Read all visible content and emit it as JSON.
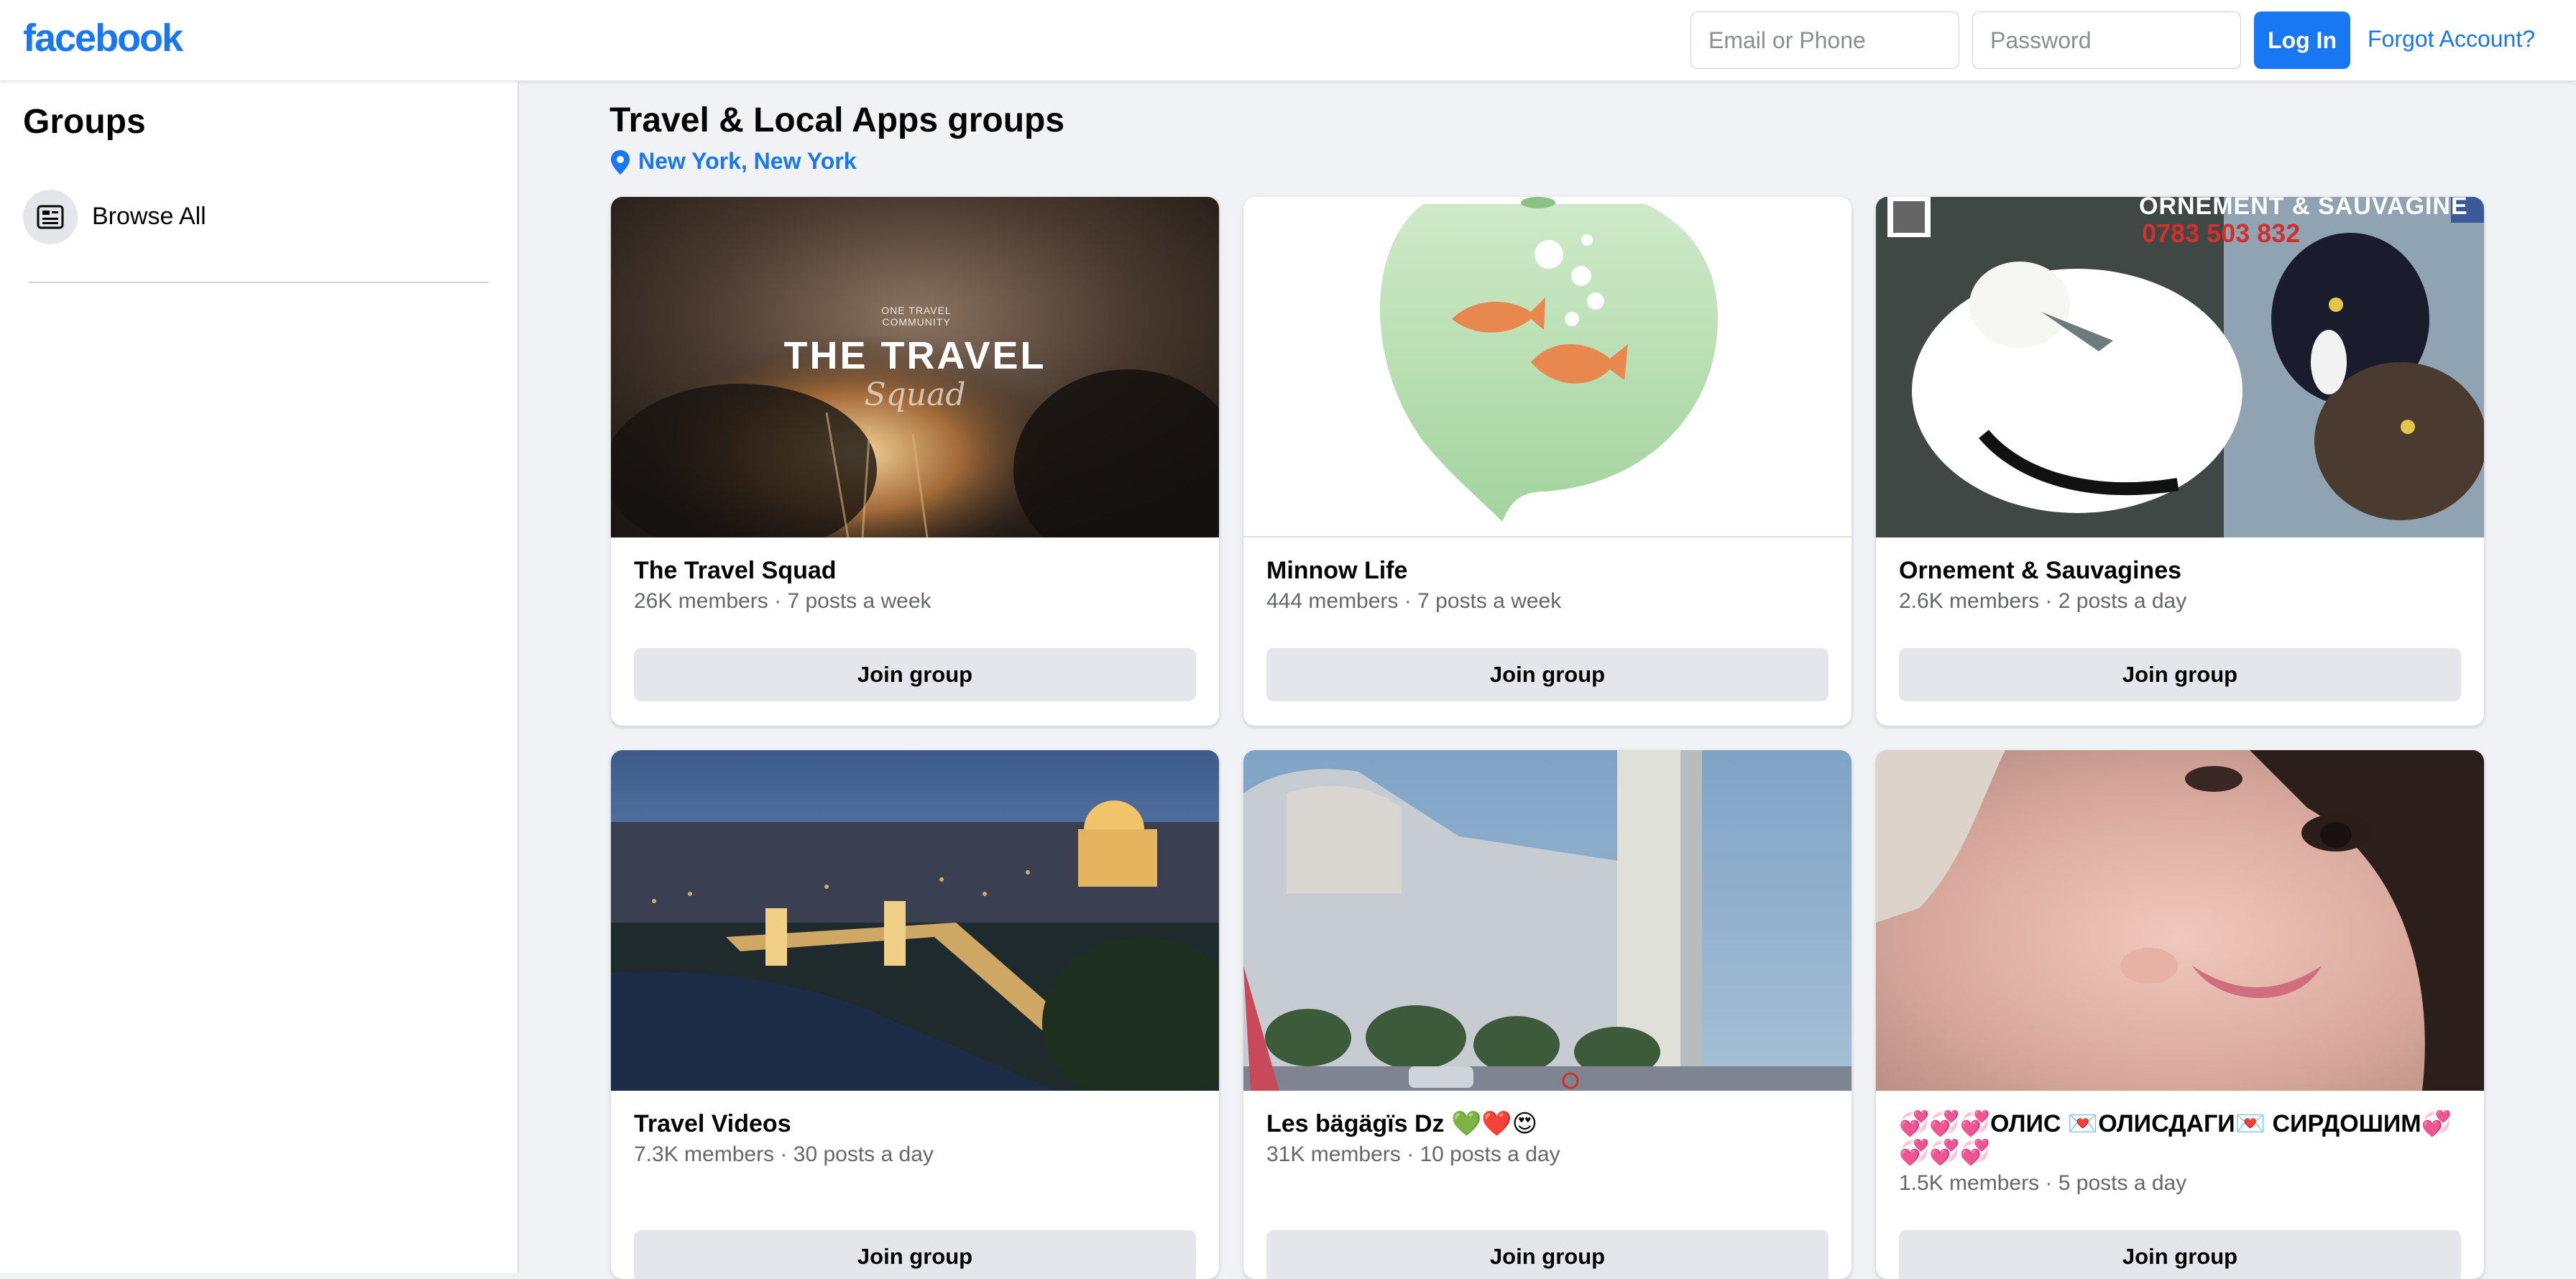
{
  "header": {
    "logo": "facebook",
    "email_placeholder": "Email or Phone",
    "password_placeholder": "Password",
    "login_label": "Log In",
    "forgot_label": "Forgot Account?"
  },
  "sidebar": {
    "title": "Groups",
    "items": [
      {
        "label": "Browse All",
        "icon": "browse-icon"
      }
    ]
  },
  "main": {
    "title": "Travel & Local Apps groups",
    "location": "New York, New York"
  },
  "groups": [
    {
      "name": "The Travel Squad",
      "members": "26K members",
      "activity": "7 posts a week",
      "cover_text": "THE TRAVEL",
      "cover_script": "Squad",
      "cover_small": "ONE TRAVEL COMMUNITY",
      "join": "Join group"
    },
    {
      "name": "Minnow Life",
      "members": "444 members",
      "activity": "7 posts a week",
      "join": "Join group"
    },
    {
      "name": "Ornement & Sauvagines",
      "members": "2.6K members",
      "activity": "2 posts a day",
      "cover_text": "ORNEMENT & SAUVAGINE",
      "cover_phone": "0783 503 832",
      "join": "Join group"
    },
    {
      "name": "Travel Videos",
      "members": "7.3K members",
      "activity": "30 posts a day",
      "join": "Join group"
    },
    {
      "name": "Les bägägïs Dz 💚❤️😍",
      "members": "31K members",
      "activity": "10 posts a day",
      "join": "Join group"
    },
    {
      "name": "💞💞💞ОЛИС 💌ОЛИСДАГИ💌 СИРДОШИМ💞💞💞💞",
      "members": "1.5K members",
      "activity": "5 posts a day",
      "join": "Join group"
    }
  ],
  "meta_separator": "·",
  "colors": {
    "brand": "#1877f2",
    "background": "#f0f2f5",
    "button_gray": "#e4e6eb"
  }
}
